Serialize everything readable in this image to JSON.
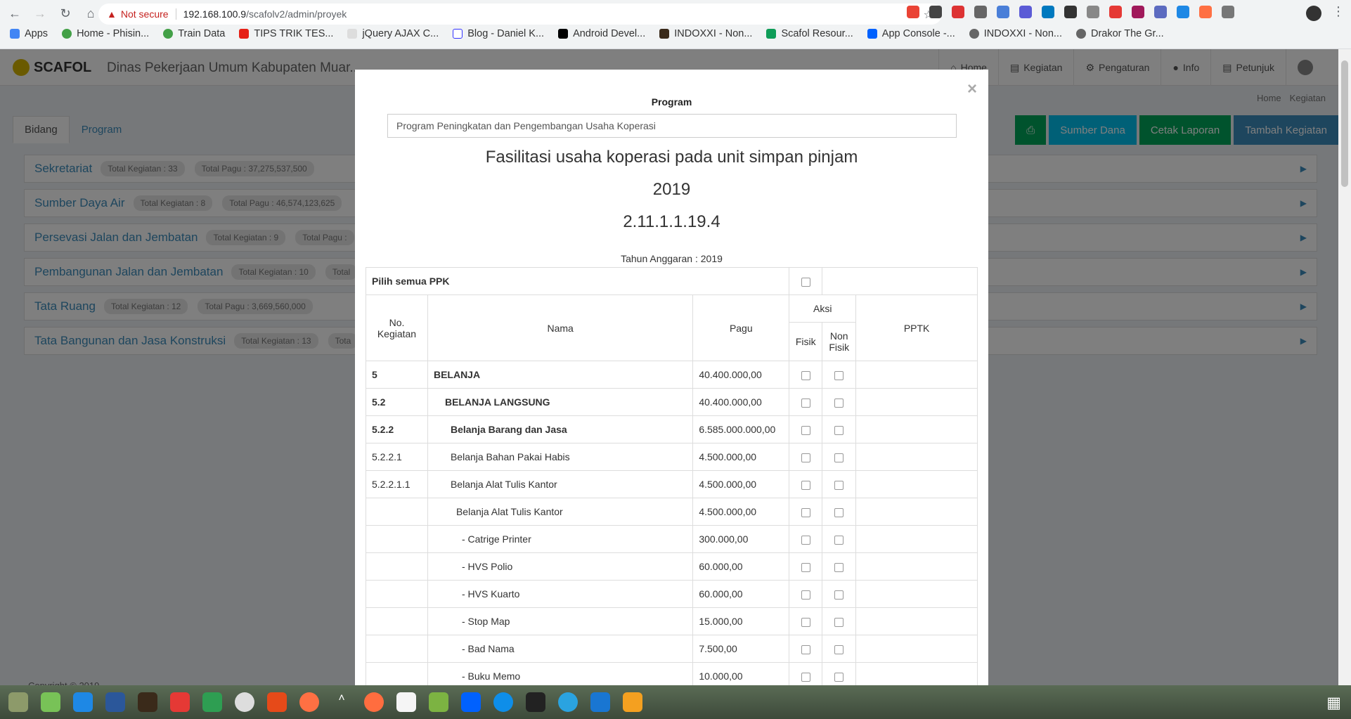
{
  "browser": {
    "security_label": "Not secure",
    "url_host": "192.168.100.9",
    "url_path": "/scafolv2/admin/proyek",
    "bookmarks": [
      "Apps",
      "Home - Phisin...",
      "Train Data",
      "TIPS TRIK TES...",
      "jQuery AJAX C...",
      "Blog - Daniel K...",
      "Android Devel...",
      "INDOXXI - Non...",
      "Scafol Resour...",
      "App Console -...",
      "INDOXXI - Non...",
      "Drakor The Gr..."
    ]
  },
  "app": {
    "logo": "SCAFOL",
    "agency": "Dinas Pekerjaan Umum Kabupaten Muar...",
    "menu": [
      "Home",
      "Kegiatan",
      "Pengaturan",
      "Info",
      "Petunjuk"
    ],
    "breadcrumb": [
      "Home",
      "Kegiatan"
    ],
    "tabs": [
      "Bidang",
      "Program"
    ],
    "actions": [
      "Sumber Dana",
      "Cetak Laporan",
      "Tambah Kegiatan"
    ],
    "bidang": [
      {
        "name": "Sekretariat",
        "kegiatan": "Total Kegiatan : 33",
        "pagu": "Total Pagu : 37,275,537,500"
      },
      {
        "name": "Sumber Daya Air",
        "kegiatan": "Total Kegiatan : 8",
        "pagu": "Total Pagu : 46,574,123,625"
      },
      {
        "name": "Persevasi Jalan dan Jembatan",
        "kegiatan": "Total Kegiatan : 9",
        "pagu": "Total Pagu :"
      },
      {
        "name": "Pembangunan Jalan dan Jembatan",
        "kegiatan": "Total Kegiatan : 10",
        "pagu": "Total"
      },
      {
        "name": "Tata Ruang",
        "kegiatan": "Total Kegiatan : 12",
        "pagu": "Total Pagu : 3,669,560,000"
      },
      {
        "name": "Tata Bangunan dan Jasa Konstruksi",
        "kegiatan": "Total Kegiatan : 13",
        "pagu": "Tota"
      }
    ],
    "footer": "Copyright © 2019"
  },
  "modal": {
    "program_label": "Program",
    "program_value": "Program Peningkatan dan Pengembangan Usaha Koperasi",
    "title": "Fasilitasi usaha koperasi pada unit simpan pinjam",
    "year": "2019",
    "code": "2.11.1.1.19.4",
    "tahun_anggaran": "Tahun Anggaran : 2019",
    "pilih_semua": "Pilih semua PPK",
    "headers": {
      "no": "No. Kegiatan",
      "nama": "Nama",
      "pagu": "Pagu",
      "aksi": "Aksi",
      "fisik": "Fisik",
      "non_fisik": "Non Fisik",
      "pptk": "PPTK"
    },
    "rows": [
      {
        "no": "5",
        "nama": "BELANJA",
        "pagu": "40.400.000,00",
        "level": 0,
        "bold": true
      },
      {
        "no": "5.2",
        "nama": "BELANJA LANGSUNG",
        "pagu": "40.400.000,00",
        "level": 1,
        "bold": true
      },
      {
        "no": "5.2.2",
        "nama": "Belanja Barang dan Jasa",
        "pagu": "6.585.000.000,00",
        "level": 2,
        "bold": true
      },
      {
        "no": "5.2.2.1",
        "nama": "Belanja Bahan Pakai Habis",
        "pagu": "4.500.000,00",
        "level": 2,
        "bold": false
      },
      {
        "no": "5.2.2.1.1",
        "nama": "Belanja Alat Tulis Kantor",
        "pagu": "4.500.000,00",
        "level": 3,
        "bold": false
      },
      {
        "no": "",
        "nama": "Belanja Alat Tulis Kantor",
        "pagu": "4.500.000,00",
        "level": 4,
        "bold": false
      },
      {
        "no": "",
        "nama": "- Catrige Printer",
        "pagu": "300.000,00",
        "level": 5,
        "bold": false
      },
      {
        "no": "",
        "nama": "- HVS Polio",
        "pagu": "60.000,00",
        "level": 5,
        "bold": false
      },
      {
        "no": "",
        "nama": "- HVS Kuarto",
        "pagu": "60.000,00",
        "level": 5,
        "bold": false
      },
      {
        "no": "",
        "nama": "- Stop Map",
        "pagu": "15.000,00",
        "level": 5,
        "bold": false
      },
      {
        "no": "",
        "nama": "- Bad Nama",
        "pagu": "7.500,00",
        "level": 5,
        "bold": false
      },
      {
        "no": "",
        "nama": "- Buku Memo",
        "pagu": "10.000,00",
        "level": 5,
        "bold": false
      }
    ]
  }
}
